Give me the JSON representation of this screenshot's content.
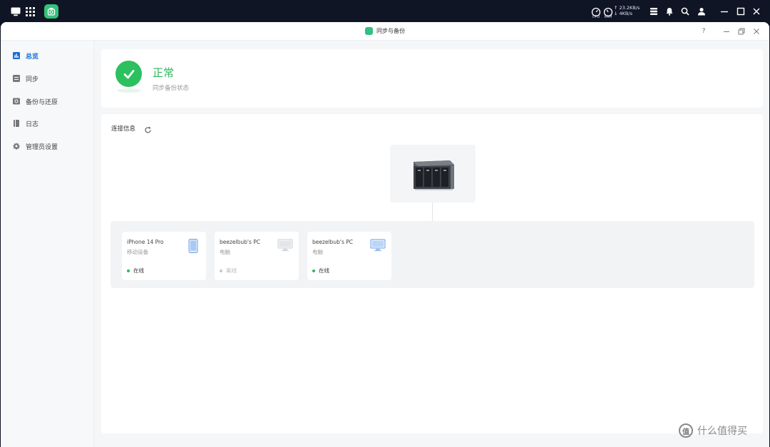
{
  "taskbar": {
    "cpu_label": "CPU",
    "ram_label": "RAM",
    "net_up": "23.2KB/s",
    "net_down": "4KB/s",
    "icons": [
      "monitor-icon",
      "app-grid-icon",
      "sync-app-icon",
      "cpu-gauge-icon",
      "ram-gauge-icon",
      "task-list-icon",
      "bell-icon",
      "search-icon",
      "user-icon",
      "minimize-icon",
      "maximize-icon",
      "close-icon"
    ]
  },
  "window": {
    "title": "同步与备份",
    "help": "?"
  },
  "sidebar": {
    "items": [
      {
        "label": "总览",
        "icon": "overview-icon",
        "active": true
      },
      {
        "label": "同步",
        "icon": "sync-icon",
        "active": false
      },
      {
        "label": "备份与还原",
        "icon": "backup-icon",
        "active": false
      },
      {
        "label": "日志",
        "icon": "log-icon",
        "active": false
      },
      {
        "label": "管理员设置",
        "icon": "gear-icon",
        "active": false
      }
    ]
  },
  "status": {
    "title": "正常",
    "subtitle": "同步备份状态",
    "color": "#2cc05f"
  },
  "connection": {
    "title": "连接信息",
    "devices": [
      {
        "name": "iPhone 14 Pro",
        "type": "移动设备",
        "status": "在线",
        "online": true,
        "icon": "phone-icon"
      },
      {
        "name": "beezelbub's PC",
        "type": "电脑",
        "status": "离线",
        "online": false,
        "icon": "monitor-icon"
      },
      {
        "name": "beezelbub's PC",
        "type": "电脑",
        "status": "在线",
        "online": true,
        "icon": "monitor-icon"
      }
    ]
  },
  "watermark": {
    "logo": "值",
    "text": "什么值得买"
  }
}
